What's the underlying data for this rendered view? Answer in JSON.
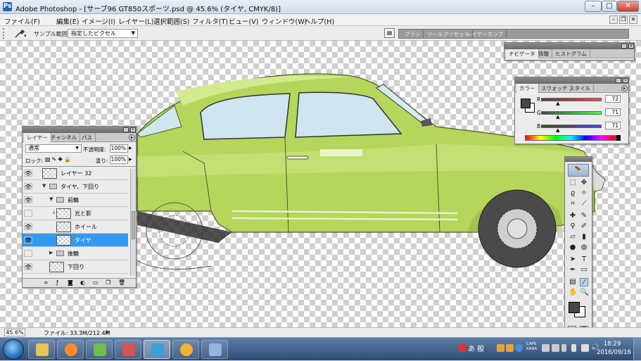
{
  "window": {
    "title": "Adobe Photoshop - [サーブ96 GT850スポーツ.psd @ 45.6% (タイヤ, CMYK/8)]",
    "app_icon": "Ps",
    "controls": {
      "minimize": "–",
      "maximize": "□",
      "close": "✕"
    }
  },
  "menu": {
    "items": [
      "ファイル(F)",
      "編集(E)",
      "イメージ(I)",
      "レイヤー(L)",
      "選択範囲(S)",
      "フィルタ(T)",
      "ビュー(V)",
      "ウィンドウ(W)",
      "ヘルプ(H)"
    ],
    "doc_controls": {
      "minimize": "–",
      "restore": "❐",
      "close": "✕"
    }
  },
  "options": {
    "tool_icon": "eyedropper-icon",
    "sample_label": "サンプル範囲：",
    "sample_value": "指定したピクセル",
    "well_tabs": [
      "ブラシ",
      "ツールプリセット",
      "レイヤーカンプ"
    ]
  },
  "navigator": {
    "tabs": [
      "ナビゲータ",
      "情報",
      "ヒストグラム"
    ]
  },
  "color_panel": {
    "tabs": [
      "カラー",
      "スウォッチ",
      "スタイル"
    ],
    "sliders": [
      {
        "label": "R",
        "value": "72",
        "level": 0.28
      },
      {
        "label": "G",
        "value": "71",
        "level": 0.28
      },
      {
        "label": "B",
        "value": "71",
        "level": 0.28
      }
    ],
    "foreground": "#484747",
    "background": "#ffffff"
  },
  "layers_panel": {
    "tabs": [
      "レイヤー",
      "チャンネル",
      "パス"
    ],
    "blend_mode": "通常",
    "opacity_label": "不透明度:",
    "opacity": "100%",
    "lock_label": "ロック:",
    "fill_label": "塗り:",
    "fill": "100%",
    "layers": [
      {
        "name": "レイヤー 32",
        "visible": true,
        "type": "layer",
        "indent": 1,
        "selected": false
      },
      {
        "name": "タイヤ、下回り",
        "visible": true,
        "type": "group",
        "indent": 1,
        "expanded": true,
        "selected": false
      },
      {
        "name": "前輪",
        "visible": true,
        "type": "group",
        "indent": 2,
        "expanded": true,
        "selected": false
      },
      {
        "name": "光と影",
        "visible": false,
        "type": "layer",
        "indent": 3,
        "clipped": true,
        "selected": false
      },
      {
        "name": "ホイール",
        "visible": true,
        "type": "layer",
        "indent": 3,
        "selected": false
      },
      {
        "name": "タイヤ",
        "visible": true,
        "type": "layer",
        "indent": 3,
        "selected": true
      },
      {
        "name": "後輪",
        "visible": false,
        "type": "group",
        "indent": 2,
        "expanded": false,
        "selected": false
      },
      {
        "name": "下回り",
        "visible": true,
        "type": "layer",
        "indent": 2,
        "selected": false
      }
    ],
    "footer_icons": [
      "link-icon",
      "fx-icon",
      "mask-icon",
      "adjustment-icon",
      "new-group-icon",
      "new-layer-icon",
      "trash-icon"
    ]
  },
  "status": {
    "zoom": "45.6%",
    "file_info": "ファイル: 33.3M/212.4M",
    "arrow": "▶"
  },
  "taskbar": {
    "apps": [
      "explorer",
      "media-player",
      "app-3",
      "app-4",
      "photoshop",
      "app-6",
      "app-7"
    ],
    "ime": "あ 般",
    "caps": "CAPS KANA",
    "time": "18:29",
    "date": "2016/09/16"
  },
  "colors": {
    "car_body": "#b5d65a",
    "car_highlight": "#d4ea8e",
    "glass": "#cfe6f0",
    "tire": "#4a4a4a",
    "selection": "#3299f0"
  }
}
